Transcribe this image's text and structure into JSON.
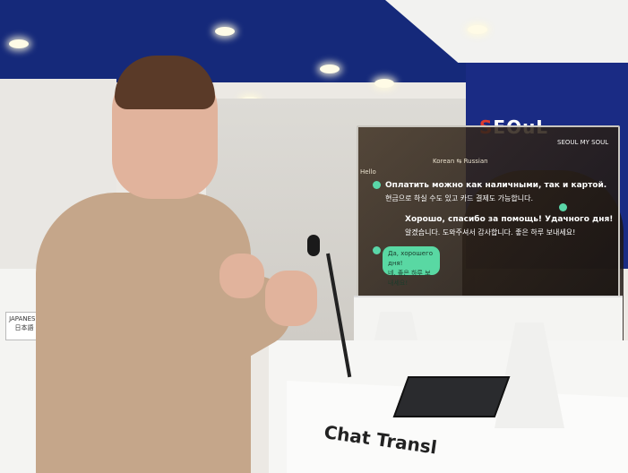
{
  "signage": {
    "brand_prefix": "S",
    "brand_rest": "EOuL",
    "panel_sub": "SEOUL MY SOUL",
    "counter_label": "Chat Transl",
    "japanese_sign_line1": "JAPANESE",
    "japanese_sign_line2": "日本語"
  },
  "screen": {
    "header": "Korean ⇆ Russian",
    "left_label": "Hello",
    "messages": [
      {
        "text": "Оплатить можно как наличными, так и картой.",
        "style": "big"
      },
      {
        "text": "현금으로 하실 수도 있고 카드 결제도 가능합니다.",
        "style": "small"
      },
      {
        "text": "Хорошо, спасибо за помощь! Удачного дня!",
        "style": "big"
      },
      {
        "text": "알겠습니다. 도와주셔서 감사합니다. 좋은 하루 보내세요!",
        "style": "small"
      }
    ],
    "bubble_line1": "Да, хорошего дня!",
    "bubble_line2": "네, 좋은 하루 보내세요!"
  }
}
